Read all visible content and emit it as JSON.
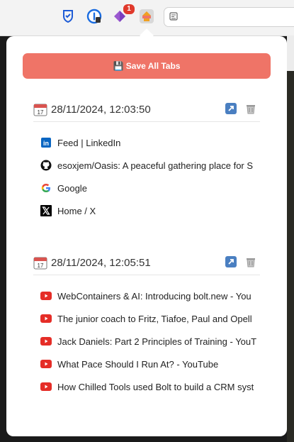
{
  "toolbar": {
    "extensions": [
      {
        "icon": "bitwarden-shield-icon"
      },
      {
        "icon": "onepassword-icon"
      },
      {
        "icon": "purple-diamond-extension-icon",
        "badge": "1"
      },
      {
        "icon": "tab-saver-extension-icon"
      }
    ]
  },
  "popup": {
    "save_button_label": "💾 Save All Tabs",
    "sessions": [
      {
        "date": "28/11/2024, 12:03:50",
        "tabs": [
          {
            "icon": "linkedin-icon",
            "title": "Feed | LinkedIn"
          },
          {
            "icon": "github-icon",
            "title": "esoxjem/Oasis: A peaceful gathering place for S"
          },
          {
            "icon": "google-icon",
            "title": "Google"
          },
          {
            "icon": "x-icon",
            "title": "Home / X"
          }
        ]
      },
      {
        "date": "28/11/2024, 12:05:51",
        "tabs": [
          {
            "icon": "youtube-icon",
            "title": "WebContainers & AI: Introducing bolt.new - You"
          },
          {
            "icon": "youtube-icon",
            "title": "The junior coach to Fritz, Tiafoe, Paul and Opell"
          },
          {
            "icon": "youtube-icon",
            "title": "Jack Daniels: Part 2 Principles of Training - YouT"
          },
          {
            "icon": "youtube-icon",
            "title": "What Pace Should I Run At? - YouTube"
          },
          {
            "icon": "youtube-icon",
            "title": "How Chilled Tools used Bolt to build a CRM syst"
          }
        ]
      }
    ]
  }
}
